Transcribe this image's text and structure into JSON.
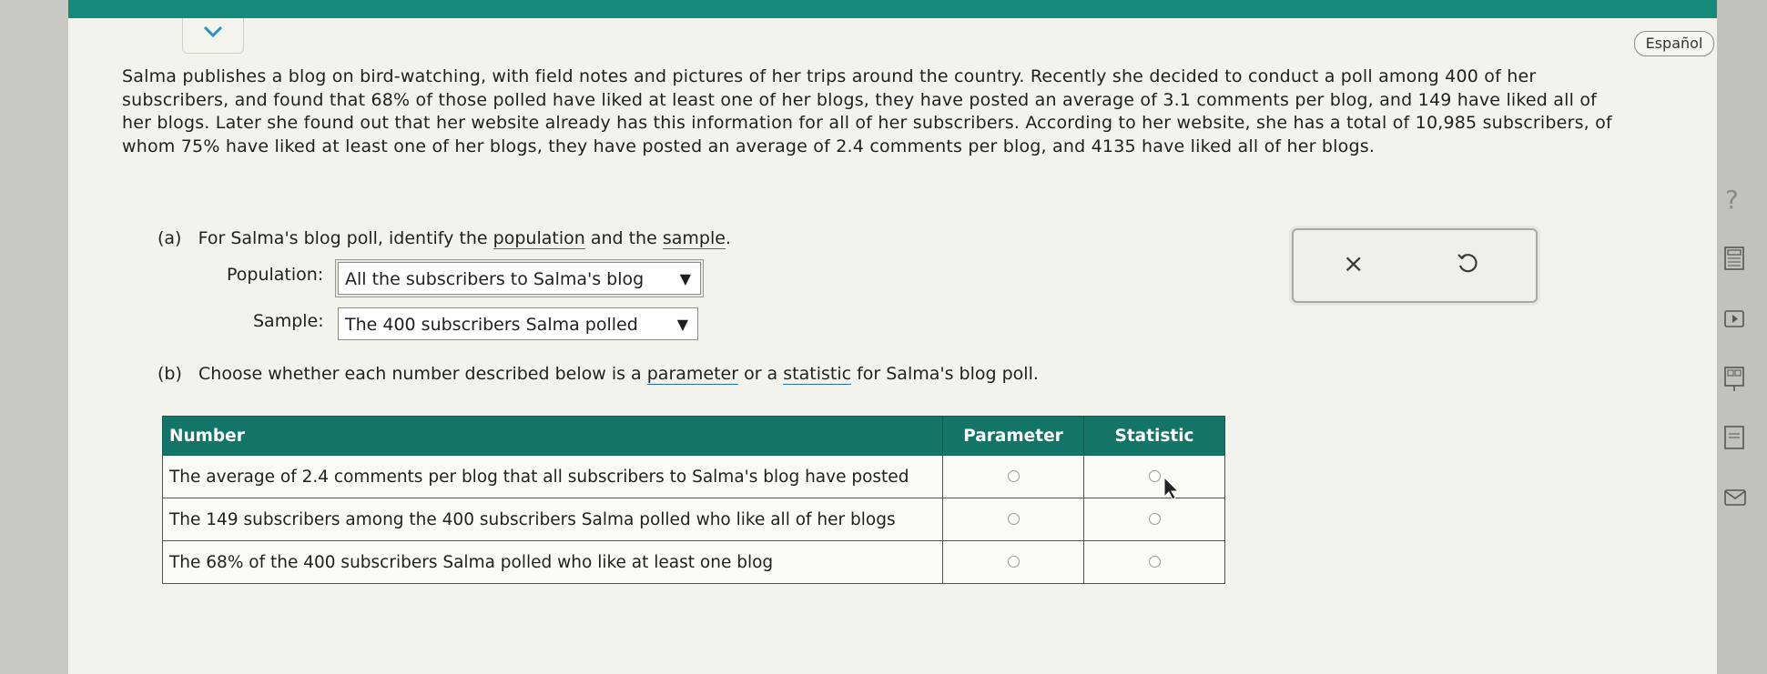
{
  "language_button": "Español",
  "problem_text": "Salma publishes a blog on bird-watching, with field notes and pictures of her trips around the country. Recently she decided to conduct a poll among 400 of her subscribers, and found that 68% of those polled have liked at least one of her blogs, they have posted an average of 3.1 comments per blog, and 149 have liked all of her blogs. Later she found out that her website already has this information for all of her subscribers. According to her website, she has a total of 10,985 subscribers, of whom 75% have liked at least one of her blogs, they have posted an average of 2.4 comments per blog, and 4135 have liked all of her blogs.",
  "part_a": {
    "label": "(a)",
    "prefix": "For Salma's blog poll, identify the ",
    "link1": "population",
    "middle": " and the ",
    "link2": "sample",
    "suffix": ".",
    "population_label": "Population:",
    "population_value": "All the subscribers to Salma's blog",
    "sample_label": "Sample:",
    "sample_value": "The 400 subscribers Salma polled"
  },
  "part_b": {
    "label": "(b)",
    "prefix": "Choose whether each number described below is a ",
    "link1": "parameter",
    "middle": " or a ",
    "link2": "statistic",
    "suffix": " for Salma's blog poll."
  },
  "table": {
    "headers": [
      "Number",
      "Parameter",
      "Statistic"
    ],
    "rows": [
      "The average of 2.4 comments per blog that all subscribers to Salma's blog have posted",
      "The 149 subscribers among the 400 subscribers Salma polled who like all of her blogs",
      "The 68% of the 400 subscribers Salma polled who like at least one blog"
    ]
  },
  "tools": {
    "clear_symbol": "×"
  },
  "help_symbol": "?",
  "dropdown_arrow": "▼",
  "icons": [
    "chevron-down-icon",
    "undo-icon",
    "calculator-icon",
    "video-icon",
    "reference-icon",
    "glossary-icon",
    "mail-icon"
  ]
}
